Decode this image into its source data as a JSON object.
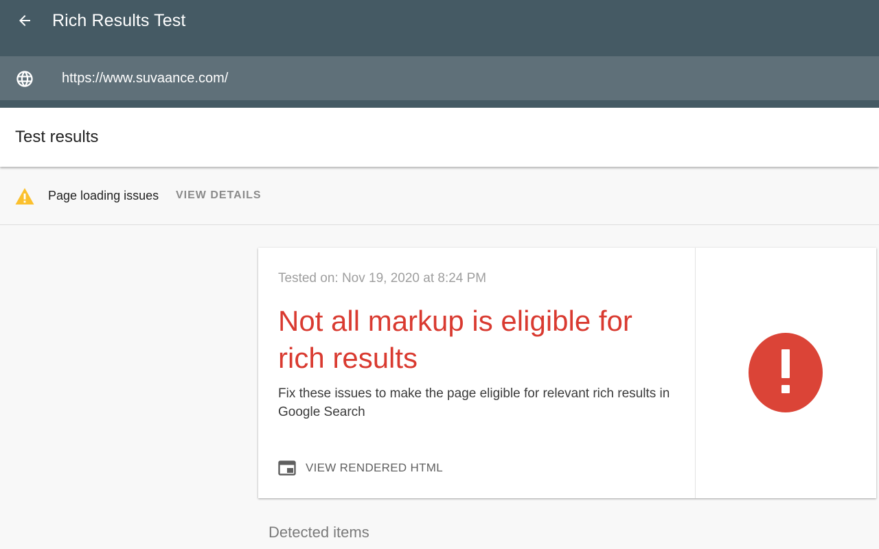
{
  "header": {
    "app_title": "Rich Results Test",
    "back_icon": "arrow-back-icon",
    "url_icon": "globe-icon",
    "url": "https://www.suvaance.com/",
    "bg_color": "#455a64",
    "url_bar_color": "#5f7079"
  },
  "results": {
    "title": "Test results"
  },
  "issue_banner": {
    "icon": "warning-icon",
    "icon_color": "#fbc02d",
    "label": "Page loading issues",
    "action": "VIEW DETAILS"
  },
  "result_card": {
    "tested_on": "Tested on: Nov 19, 2020 at 8:24 PM",
    "headline": "Not all markup is eligible for rich results",
    "headline_color": "#d93a30",
    "description": "Fix these issues to make the page eligible for relevant rich results in Google Search",
    "view_html_icon": "browser-window-icon",
    "view_html_label": "VIEW RENDERED HTML",
    "status_icon": "error-exclamation-icon",
    "status_color": "#db4437"
  },
  "detected": {
    "label": "Detected items"
  }
}
